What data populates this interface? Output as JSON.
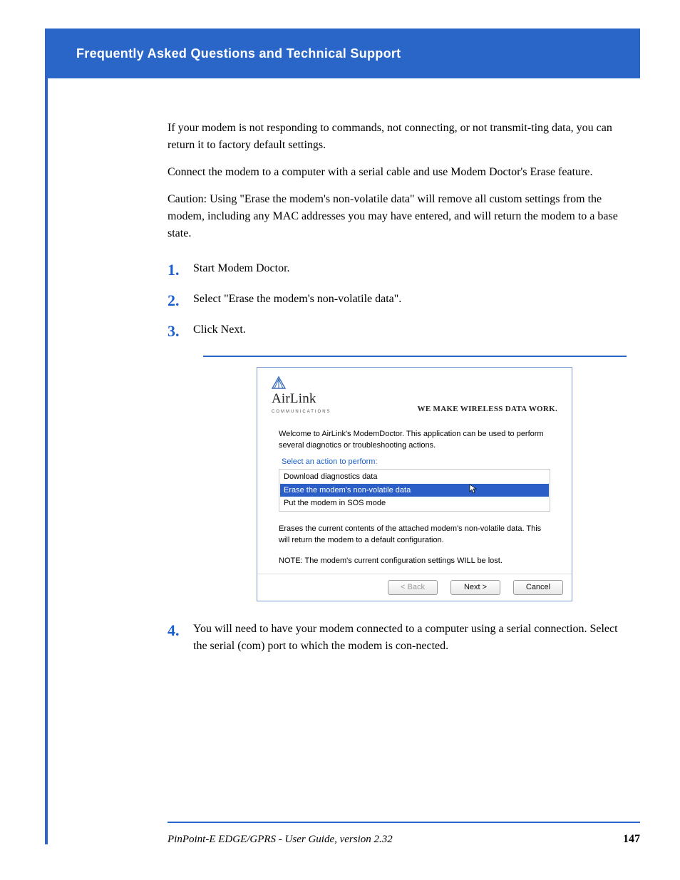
{
  "header": {
    "title": "Frequently Asked Questions and Technical Support"
  },
  "body": {
    "intro1": "If your modem is not responding to commands, not connecting, or not transmit-ting data, you can return it to factory default settings.",
    "intro2": "Connect the modem to a computer with a serial cable and use Modem Doctor's Erase feature.",
    "caution": "Caution: Using \"Erase the modem's non-volatile data\" will remove all custom settings from the modem, including any MAC addresses you may have entered, and will return the modem to a base state.",
    "steps": [
      "Start Modem Doctor.",
      "Select \"Erase the modem's non-volatile data\".",
      "Click Next."
    ],
    "step4": "You will need to have your modem connected to a computer using a serial connection. Select the serial (com) port to which the modem is con-nected."
  },
  "wizard": {
    "brand": "AirLink",
    "brand_sub": "COMMUNICATIONS",
    "tagline": "WE MAKE WIRELESS DATA WORK.",
    "welcome": "Welcome to AirLink's ModemDoctor. This application can be used to perform several diagnotics or troubleshooting actions.",
    "fieldset_label": "Select an action to perform:",
    "options": [
      "Download diagnostics data",
      "Erase the modem's non-volatile data",
      "Put the modem in SOS mode"
    ],
    "selected_index": 1,
    "desc": "Erases the current contents of the attached modem's non-volatile data. This will return the modem to a default configuration.",
    "note": "NOTE: The modem's current configuration settings WILL be lost.",
    "buttons": {
      "back": "< Back",
      "next": "Next >",
      "cancel": "Cancel"
    }
  },
  "footer": {
    "doc": "PinPoint-E EDGE/GPRS - User Guide, version 2.32",
    "page": "147"
  }
}
